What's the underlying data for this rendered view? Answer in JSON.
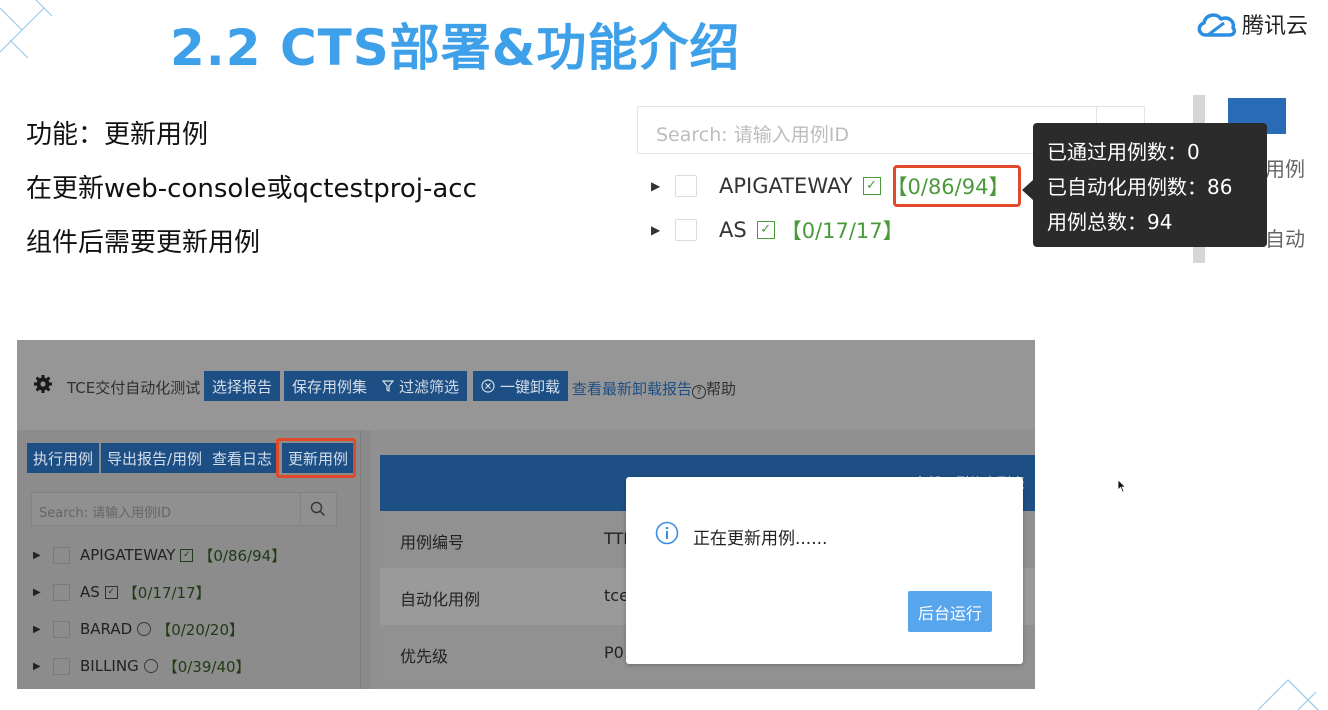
{
  "slide": {
    "title": "2.2 CTS部署&功能介绍",
    "brand": "腾讯云",
    "bullets": [
      "功能：更新用例",
      "在更新web-console或qctestproj-acc",
      "组件后需要更新用例"
    ]
  },
  "zoom_panel": {
    "search_placeholder": "Search: 请输入用例ID",
    "rows": [
      {
        "name": "APIGATEWAY",
        "count": "【0/86/94】"
      },
      {
        "name": "AS",
        "count": "【0/17/17】"
      }
    ],
    "tooltip": {
      "passed": "已通过用例数：0",
      "automated": "已自动化用例数：86",
      "total": "用例总数：94"
    },
    "side_text_1": "用例",
    "side_text_2": "自动"
  },
  "app": {
    "breadcrumb": "TCE交付自动化测试 /",
    "toolbar": {
      "select_report": "选择报告",
      "save_caseset": "保存用例集",
      "filter": "过滤筛选",
      "one_click_uninstall": "一键卸载",
      "view_latest_report": "查看最新卸载报告",
      "help": "帮助"
    },
    "left_buttons": {
      "run": "执行用例",
      "export": "导出报告/用例",
      "view_log": "查看日志",
      "update": "更新用例"
    },
    "search_placeholder": "Search: 请输入用例ID",
    "tree": [
      {
        "name": "APIGATEWAY",
        "status": "check",
        "count": "【0/86/94】"
      },
      {
        "name": "AS",
        "status": "check",
        "count": "【0/17/17】"
      },
      {
        "name": "BARAD",
        "status": "clock",
        "count": "【0/20/20】"
      },
      {
        "name": "BILLING",
        "status": "clock",
        "count": "【0/39/40】"
      }
    ],
    "detail_header": "全部用例信息列表",
    "detail_rows": [
      {
        "label": "用例编号",
        "value": "TTE"
      },
      {
        "label": "自动化用例",
        "value": "tce"
      },
      {
        "label": "优先级",
        "value": "P0"
      }
    ]
  },
  "modal": {
    "message": "正在更新用例......",
    "button": "后台运行"
  },
  "colors": {
    "title": "#3da0e8",
    "highlight": "#e04a2a",
    "count_green": "#4a9a3c",
    "app_blue": "#1e4f84",
    "modal_button": "#57a5ec"
  }
}
